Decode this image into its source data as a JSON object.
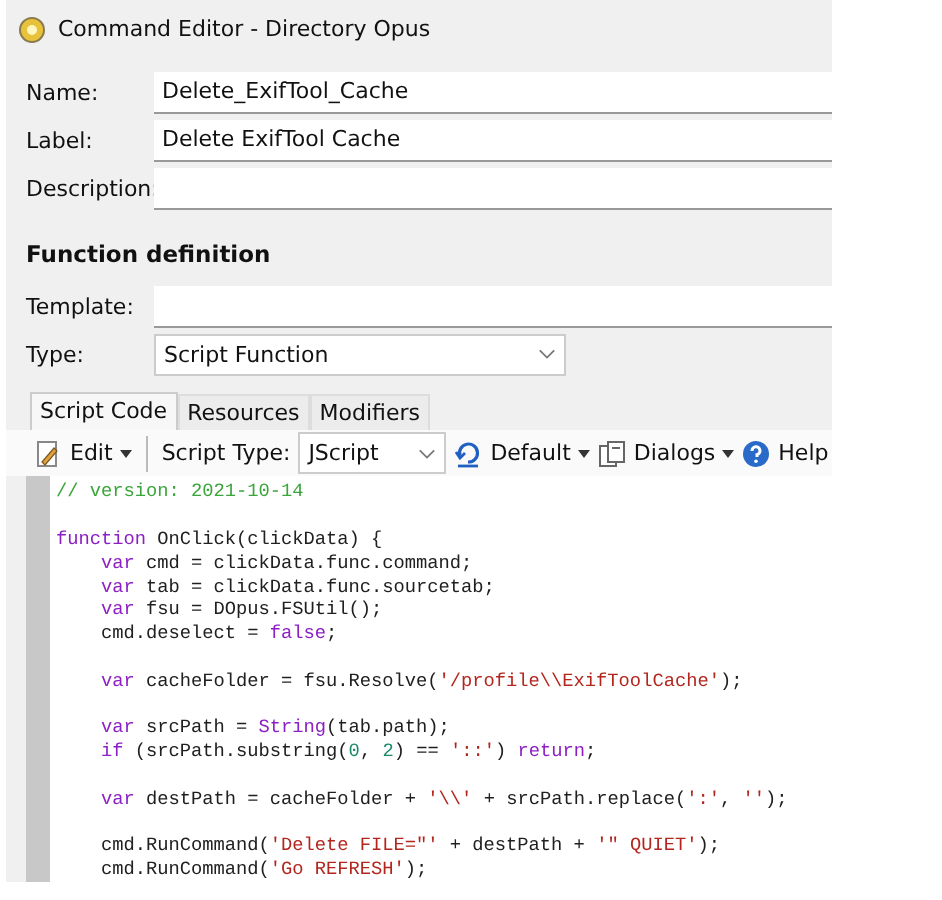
{
  "window": {
    "title": "Command Editor - Directory Opus"
  },
  "fields": [
    {
      "label": "Name:",
      "value": "Delete_ExifTool_Cache"
    },
    {
      "label": "Label:",
      "value": "Delete ExifTool Cache"
    },
    {
      "label": "Description:"
    }
  ],
  "section_title": "Function definition",
  "template": {
    "label": "Template:"
  },
  "type": {
    "label": "Type:",
    "value": "Script Function"
  },
  "tabs": [
    {
      "label": "Script Code",
      "selected": true
    },
    {
      "label": "Resources",
      "selected": false
    },
    {
      "label": "Modifiers",
      "selected": false
    }
  ],
  "toolbar": {
    "edit": "Edit",
    "script_type_label": "Script Type:",
    "script_type": "JScript",
    "default": "Default",
    "dialogs": "Dialogs",
    "help": "Help"
  },
  "code": [
    {
      "kind": "code",
      "tokens": [
        {
          "kind": "comment",
          "text": "// version: 2021-10-14"
        }
      ]
    },
    {
      "kind": "blank"
    },
    {
      "kind": "code",
      "tokens": [
        {
          "kind": "kw",
          "text": "function"
        },
        {
          "kind": "plain",
          "text": " OnClick(clickData) {"
        }
      ]
    },
    {
      "kind": "code",
      "tokens": [
        {
          "kind": "kw",
          "text": "    var"
        },
        {
          "kind": "plain",
          "text": " cmd = clickData.func.command;"
        }
      ]
    },
    {
      "kind": "code",
      "tokens": [
        {
          "kind": "kw",
          "text": "    var"
        },
        {
          "kind": "plain",
          "text": " tab = clickData.func.sourcetab;"
        }
      ]
    },
    {
      "kind": "code",
      "tokens": [
        {
          "kind": "kw",
          "text": "    var"
        },
        {
          "kind": "plain",
          "text": " fsu = DOpus.FSUtil();"
        }
      ]
    },
    {
      "kind": "code",
      "tokens": [
        {
          "kind": "plain",
          "text": "    cmd.deselect = "
        },
        {
          "kind": "kw",
          "text": "false"
        },
        {
          "kind": "plain",
          "text": ";"
        }
      ]
    },
    {
      "kind": "blank"
    },
    {
      "kind": "code",
      "tokens": [
        {
          "kind": "kw",
          "text": "    var"
        },
        {
          "kind": "plain",
          "text": " cacheFolder = fsu.Resolve("
        },
        {
          "kind": "str",
          "text": "'/profile\\\\ExifToolCache'"
        },
        {
          "kind": "plain",
          "text": ");"
        }
      ]
    },
    {
      "kind": "blank"
    },
    {
      "kind": "code",
      "tokens": [
        {
          "kind": "kw",
          "text": "    var"
        },
        {
          "kind": "plain",
          "text": " srcPath = "
        },
        {
          "kind": "kw",
          "text": "String"
        },
        {
          "kind": "plain",
          "text": "(tab.path);"
        }
      ]
    },
    {
      "kind": "code",
      "tokens": [
        {
          "kind": "kw",
          "text": "    if"
        },
        {
          "kind": "plain",
          "text": " (srcPath.substring("
        },
        {
          "kind": "num",
          "text": "0"
        },
        {
          "kind": "plain",
          "text": ", "
        },
        {
          "kind": "num",
          "text": "2"
        },
        {
          "kind": "plain",
          "text": ") == "
        },
        {
          "kind": "str",
          "text": "'::'"
        },
        {
          "kind": "plain",
          "text": ") "
        },
        {
          "kind": "kw",
          "text": "return"
        },
        {
          "kind": "plain",
          "text": ";"
        }
      ]
    },
    {
      "kind": "blank"
    },
    {
      "kind": "code",
      "tokens": [
        {
          "kind": "kw",
          "text": "    var"
        },
        {
          "kind": "plain",
          "text": " destPath = cacheFolder + "
        },
        {
          "kind": "str",
          "text": "'\\\\'"
        },
        {
          "kind": "plain",
          "text": " + srcPath.replace("
        },
        {
          "kind": "str",
          "text": "':'"
        },
        {
          "kind": "plain",
          "text": ", "
        },
        {
          "kind": "str",
          "text": "''"
        },
        {
          "kind": "plain",
          "text": ");"
        }
      ]
    },
    {
      "kind": "blank"
    },
    {
      "kind": "code",
      "tokens": [
        {
          "kind": "plain",
          "text": "    cmd.RunCommand("
        },
        {
          "kind": "str",
          "text": "'Delete FILE=\"'"
        },
        {
          "kind": "plain",
          "text": " + destPath + "
        },
        {
          "kind": "str",
          "text": "'\" QUIET'"
        },
        {
          "kind": "plain",
          "text": ");"
        }
      ]
    },
    {
      "kind": "code",
      "tokens": [
        {
          "kind": "plain",
          "text": "    cmd.RunCommand("
        },
        {
          "kind": "str",
          "text": "'Go REFRESH'"
        },
        {
          "kind": "plain",
          "text": ");"
        }
      ]
    }
  ]
}
